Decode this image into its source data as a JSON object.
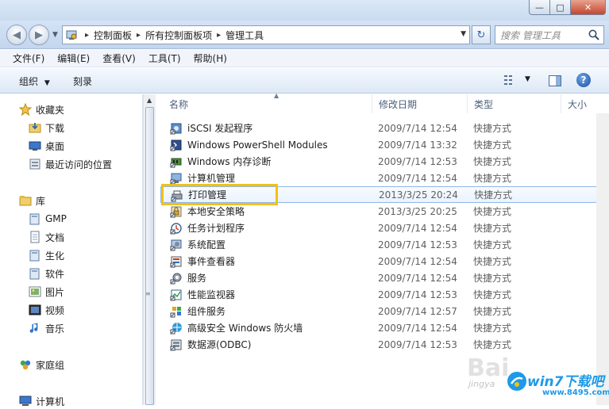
{
  "navbar": {
    "breadcrumbs": [
      "控制面板",
      "所有控制面板项",
      "管理工具"
    ],
    "search_placeholder": "搜索 管理工具"
  },
  "menubar": {
    "items": [
      "文件(F)",
      "编辑(E)",
      "查看(V)",
      "工具(T)",
      "帮助(H)"
    ]
  },
  "toolbar": {
    "organize_label": "组织",
    "burn_label": "刻录"
  },
  "nav_pane": {
    "favorites": {
      "label": "收藏夹",
      "items": [
        "下载",
        "桌面",
        "最近访问的位置"
      ]
    },
    "libraries": {
      "label": "库",
      "items": [
        "GMP",
        "文档",
        "生化",
        "软件",
        "图片",
        "视频",
        "音乐"
      ]
    },
    "homegroup_label": "家庭组",
    "computer_label": "计算机"
  },
  "columns": {
    "name": "名称",
    "date": "修改日期",
    "type": "类型",
    "size": "大小"
  },
  "files": [
    {
      "name": "iSCSI 发起程序",
      "date": "2009/7/14 12:54",
      "type": "快捷方式"
    },
    {
      "name": "Windows PowerShell Modules",
      "date": "2009/7/14 13:32",
      "type": "快捷方式"
    },
    {
      "name": "Windows 内存诊断",
      "date": "2009/7/14 12:53",
      "type": "快捷方式"
    },
    {
      "name": "计算机管理",
      "date": "2009/7/14 12:54",
      "type": "快捷方式"
    },
    {
      "name": "打印管理",
      "date": "2013/3/25 20:24",
      "type": "快捷方式"
    },
    {
      "name": "本地安全策略",
      "date": "2013/3/25 20:25",
      "type": "快捷方式"
    },
    {
      "name": "任务计划程序",
      "date": "2009/7/14 12:54",
      "type": "快捷方式"
    },
    {
      "name": "系统配置",
      "date": "2009/7/14 12:53",
      "type": "快捷方式"
    },
    {
      "name": "事件查看器",
      "date": "2009/7/14 12:54",
      "type": "快捷方式"
    },
    {
      "name": "服务",
      "date": "2009/7/14 12:54",
      "type": "快捷方式"
    },
    {
      "name": "性能监视器",
      "date": "2009/7/14 12:53",
      "type": "快捷方式"
    },
    {
      "name": "组件服务",
      "date": "2009/7/14 12:57",
      "type": "快捷方式"
    },
    {
      "name": "高级安全 Windows 防火墙",
      "date": "2009/7/14 12:54",
      "type": "快捷方式"
    },
    {
      "name": "数据源(ODBC)",
      "date": "2009/7/14 12:53",
      "type": "快捷方式"
    }
  ],
  "watermark": {
    "baidu": "Bai",
    "jingyan": "jingya",
    "brand": "win7下载吧",
    "url": "www.8495.com"
  },
  "colors": {
    "highlight_box": "#f2c116",
    "accent": "#1d9ae8"
  }
}
